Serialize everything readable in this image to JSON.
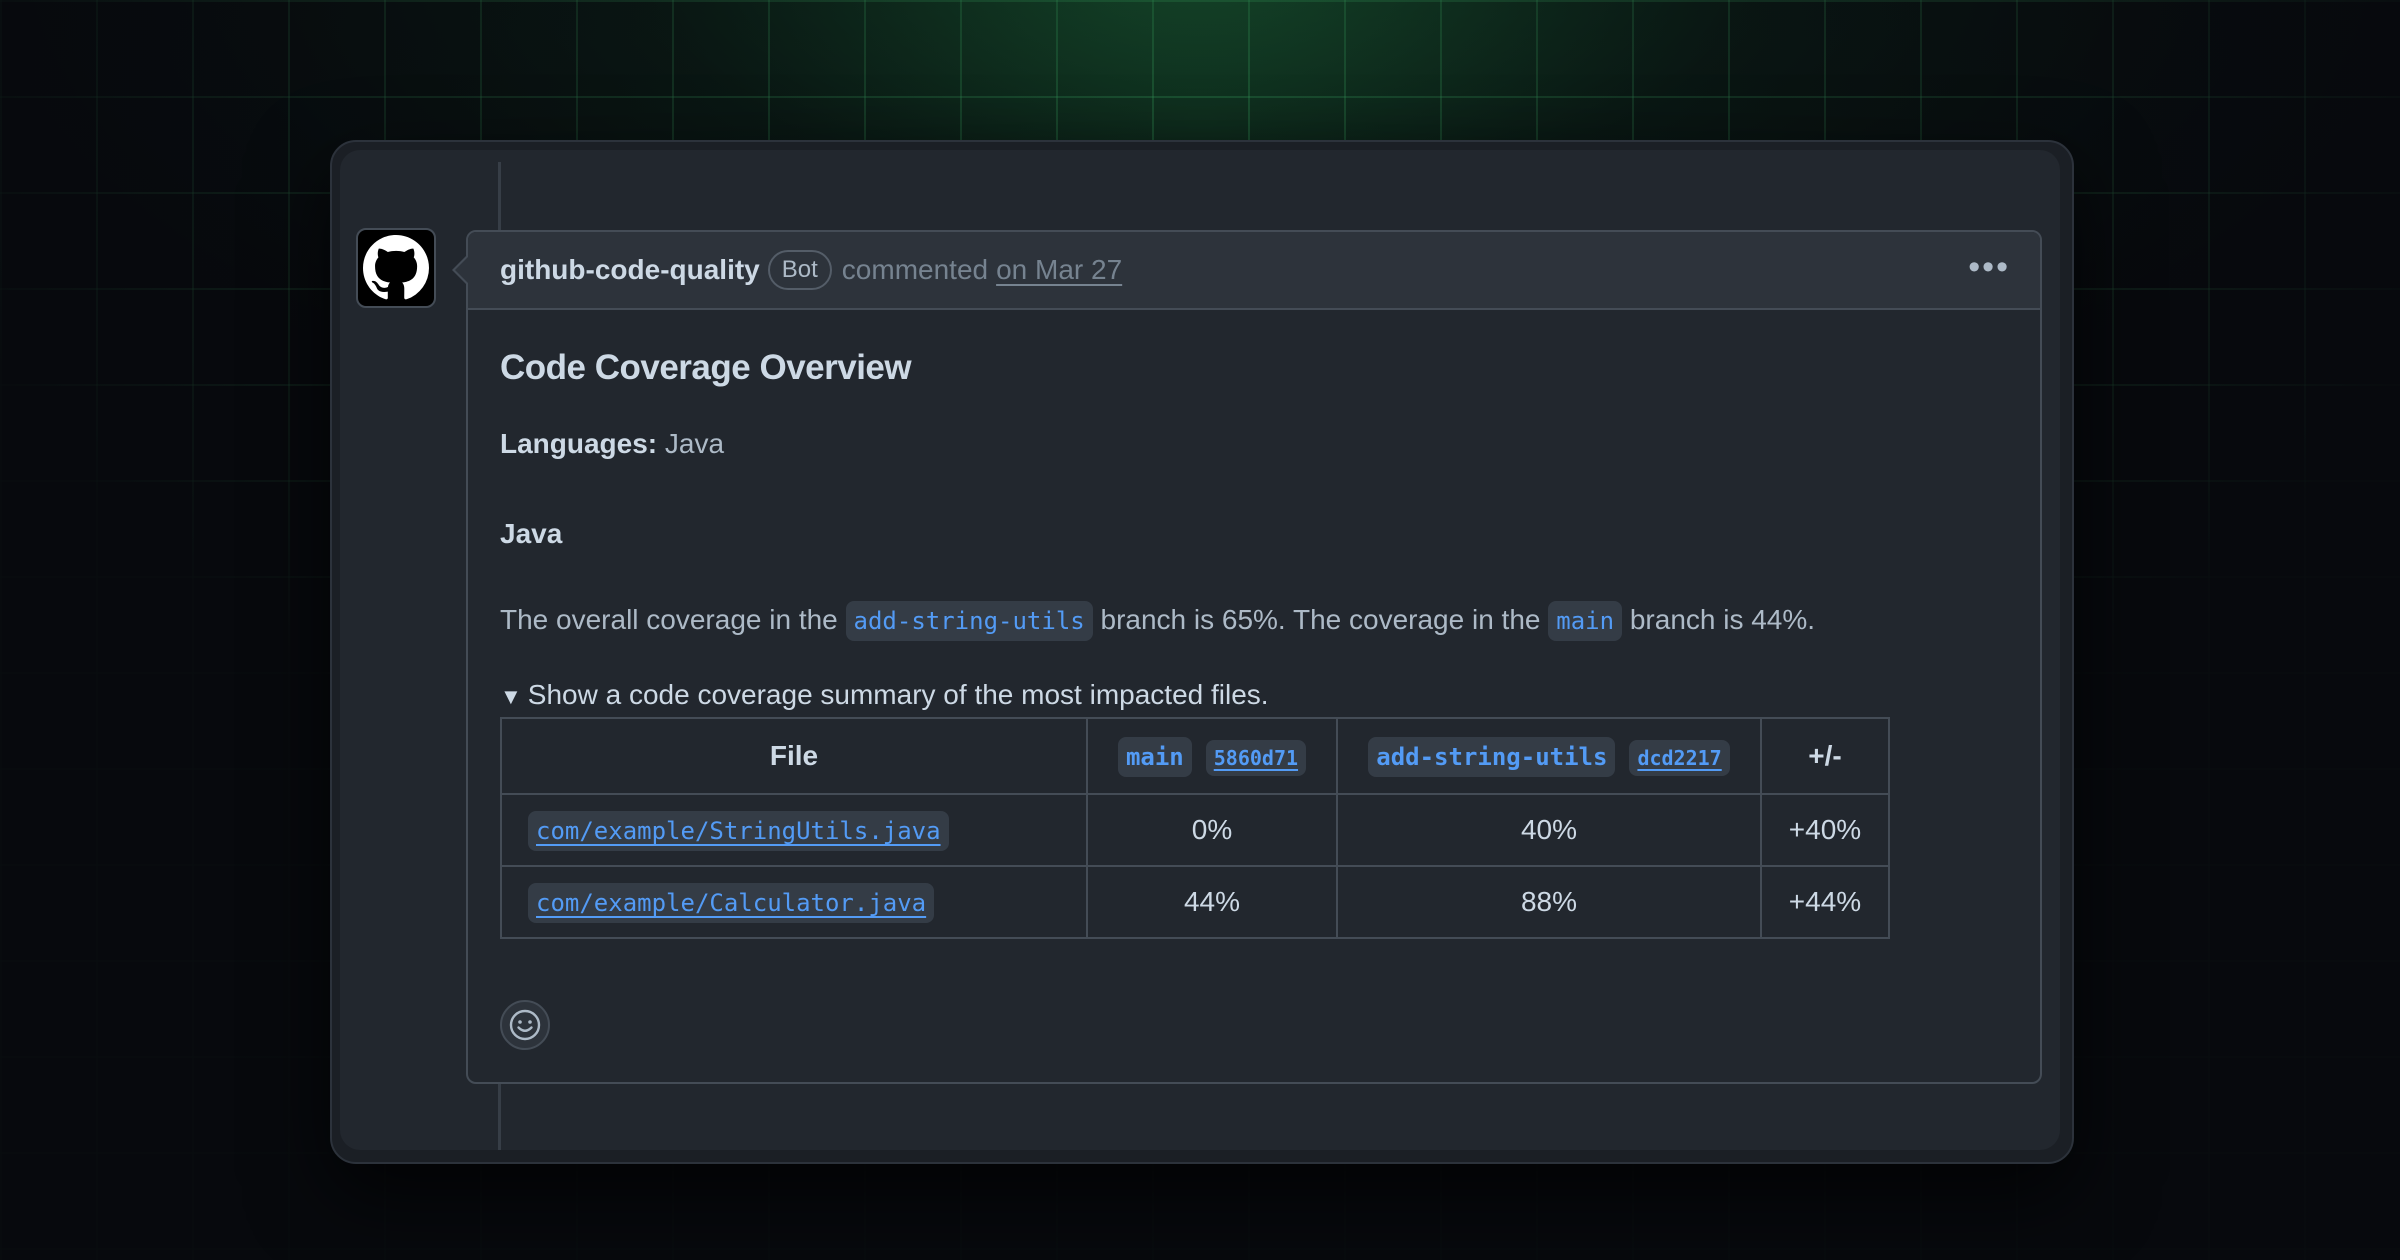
{
  "comment": {
    "author": "github-code-quality",
    "badge": "Bot",
    "action": "commented",
    "date": "on Mar 27",
    "more_icon": "kebab-horizontal-icon",
    "avatar_icon": "github-mark-icon",
    "reaction_icon": "smiley-icon"
  },
  "body": {
    "heading": "Code Coverage Overview",
    "languages_label": "Languages:",
    "languages_value": "Java",
    "section_heading": "Java",
    "coverage": {
      "text1": "The overall coverage in the",
      "branch": "add-string-utils",
      "text2": "branch is 65%. The coverage in the",
      "base": "main",
      "text3": "branch is 44%."
    },
    "summary": "Show a code coverage summary of the most impacted files."
  },
  "table": {
    "header": {
      "file": "File",
      "base_branch": "main",
      "base_sha": "5860d71",
      "head_branch": "add-string-utils",
      "head_sha": "dcd2217",
      "diff": "+/-"
    },
    "rows": [
      {
        "file": "com/example/StringUtils.java",
        "main": "0%",
        "head": "40%",
        "diff": "+40%"
      },
      {
        "file": "com/example/Calculator.java",
        "main": "44%",
        "head": "88%",
        "diff": "+44%"
      }
    ]
  },
  "colors": {
    "accent": "#539bf5",
    "panel_bg": "#22272e",
    "header_bg": "#2d333b",
    "border": "#444c56",
    "grid": "#48c474"
  }
}
